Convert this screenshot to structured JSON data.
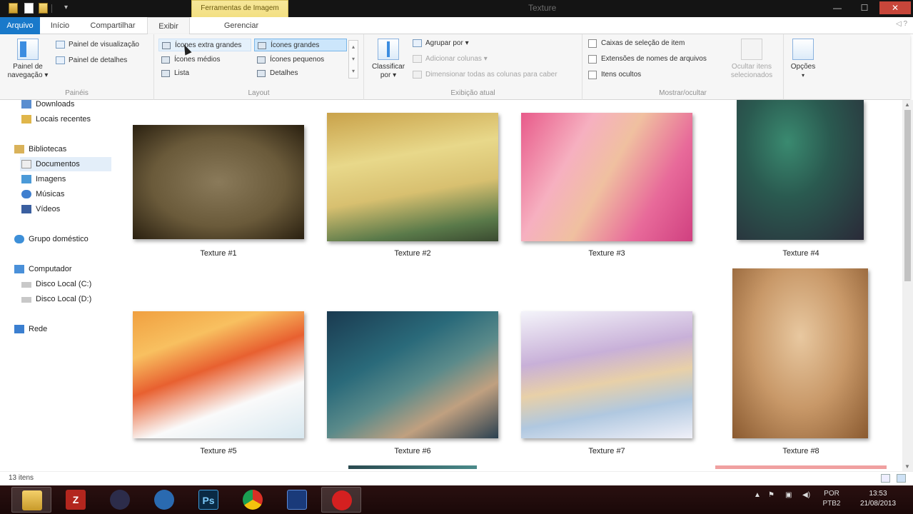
{
  "window": {
    "title": "Texture",
    "contextual_tab_group": "Ferramentas de Imagem"
  },
  "tabs": {
    "file": "Arquivo",
    "inicio": "Início",
    "compartilhar": "Compartilhar",
    "exibir": "Exibir",
    "gerenciar": "Gerenciar"
  },
  "ribbon": {
    "paineis": {
      "label": "Painéis",
      "navigation_pane": "Painel de navegação ▾",
      "preview_pane": "Painel de visualização",
      "details_pane": "Painel de detalhes"
    },
    "layout": {
      "label": "Layout",
      "items": [
        "Ícones extra grandes",
        "Ícones grandes",
        "Ícones médios",
        "Ícones pequenos",
        "Lista",
        "Detalhes"
      ]
    },
    "modo_atual": {
      "label": "Exibição atual",
      "sort_by": "Classificar por ▾",
      "group_by": "Agrupar por ▾",
      "add_columns": "Adicionar colunas ▾",
      "fit_columns": "Dimensionar todas as colunas para caber"
    },
    "mostrar": {
      "label": "Mostrar/ocultar",
      "checkboxes": [
        "Caixas de seleção de item",
        "Extensões de nomes de arquivos",
        "Itens ocultos"
      ],
      "hide_selected": "Ocultar itens selecionados"
    },
    "opcoes": {
      "label": "Opções"
    }
  },
  "nav": {
    "items": [
      {
        "label": "Downloads",
        "icon": "downloads-icon"
      },
      {
        "label": "Locais recentes",
        "icon": "recent-places-icon"
      },
      {
        "label": "Bibliotecas",
        "icon": "libraries-icon"
      },
      {
        "label": "Documentos",
        "icon": "documents-icon"
      },
      {
        "label": "Imagens",
        "icon": "images-icon"
      },
      {
        "label": "Músicas",
        "icon": "music-icon"
      },
      {
        "label": "Vídeos",
        "icon": "videos-icon"
      },
      {
        "label": "Grupo doméstico",
        "icon": "homegroup-icon"
      },
      {
        "label": "Computador",
        "icon": "computer-icon"
      },
      {
        "label": "Disco Local (C:)",
        "icon": "drive-icon"
      },
      {
        "label": "Disco Local (D:)",
        "icon": "drive-icon"
      },
      {
        "label": "Rede",
        "icon": "network-icon"
      }
    ]
  },
  "files": [
    {
      "name": "Texture #1"
    },
    {
      "name": "Texture #2"
    },
    {
      "name": "Texture #3"
    },
    {
      "name": "Texture #4"
    },
    {
      "name": "Texture #5"
    },
    {
      "name": "Texture #6"
    },
    {
      "name": "Texture #7"
    },
    {
      "name": "Texture #8"
    }
  ],
  "status": {
    "item_count": "13 itens"
  },
  "taskbar": {
    "apps": [
      "file-explorer",
      "filezilla",
      "eclipse",
      "browser-globe",
      "photoshop",
      "chrome",
      "app-blue",
      "recorder"
    ],
    "language": "POR",
    "keyboard": "PTB2",
    "time": "13:53",
    "date": "21/08/2013"
  },
  "colors": {
    "file_tab": "#1979ca",
    "contextual_tab": "#efd86a",
    "close_button": "#c7463a",
    "selected_layout": "#cce6fb"
  }
}
